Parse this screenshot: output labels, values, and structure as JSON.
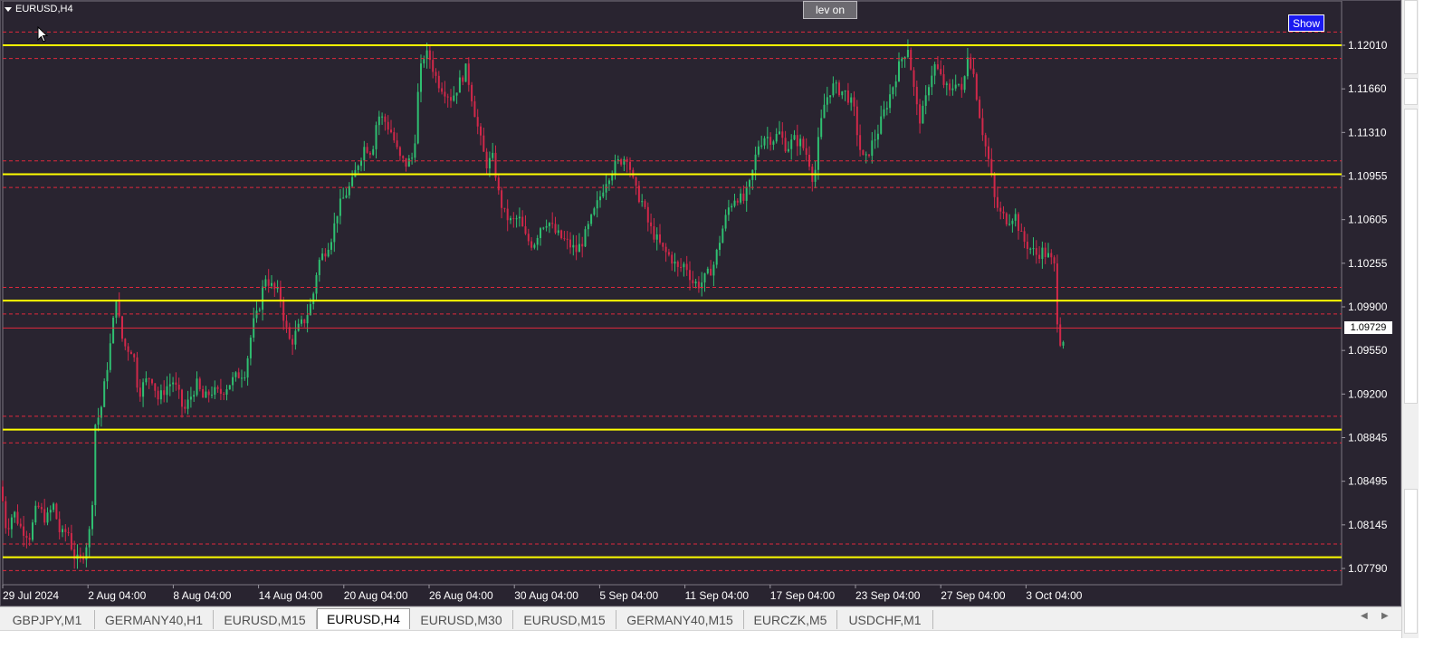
{
  "chart": {
    "symbol": "EURUSD,H4",
    "lev_button": "lev on",
    "show_button": "Show",
    "current_price": "1.09729",
    "price_labels": [
      "1.12010",
      "1.11660",
      "1.11310",
      "1.10955",
      "1.10605",
      "1.10255",
      "1.09900",
      "1.09550",
      "1.09200",
      "1.08845",
      "1.08495",
      "1.08145",
      "1.07790"
    ],
    "time_labels": [
      "29 Jul 2024",
      "2 Aug 04:00",
      "8 Aug 04:00",
      "14 Aug 04:00",
      "20 Aug 04:00",
      "26 Aug 04:00",
      "30 Aug 04:00",
      "5 Sep 04:00",
      "11 Sep 04:00",
      "17 Sep 04:00",
      "23 Sep 04:00",
      "27 Sep 04:00",
      "3 Oct 04:00"
    ],
    "price_range": [
      1.0779,
      1.1201
    ],
    "support_resistance_levels": [
      1.1201,
      1.1097,
      1.0995,
      1.0891,
      1.0788
    ],
    "current_price_value": 1.09729,
    "colors": {
      "background": "#292430",
      "bull_candle": "#2fbf71",
      "bear_candle": "#d0284a",
      "level_line": "#ffff00",
      "band_line": "#e0283c",
      "price_line": "#e0283c",
      "axis_text": "#ffffff"
    }
  },
  "tabs": [
    {
      "label": "GBPJPY,M1",
      "active": false
    },
    {
      "label": "GERMANY40,H1",
      "active": false
    },
    {
      "label": "EURUSD,M15",
      "active": false
    },
    {
      "label": "EURUSD,H4",
      "active": true
    },
    {
      "label": "EURUSD,M30",
      "active": false
    },
    {
      "label": "EURUSD,M15",
      "active": false
    },
    {
      "label": "GERMANY40,M15",
      "active": false
    },
    {
      "label": "EURCZK,M5",
      "active": false
    },
    {
      "label": "USDCHF,M1",
      "active": false
    }
  ]
}
